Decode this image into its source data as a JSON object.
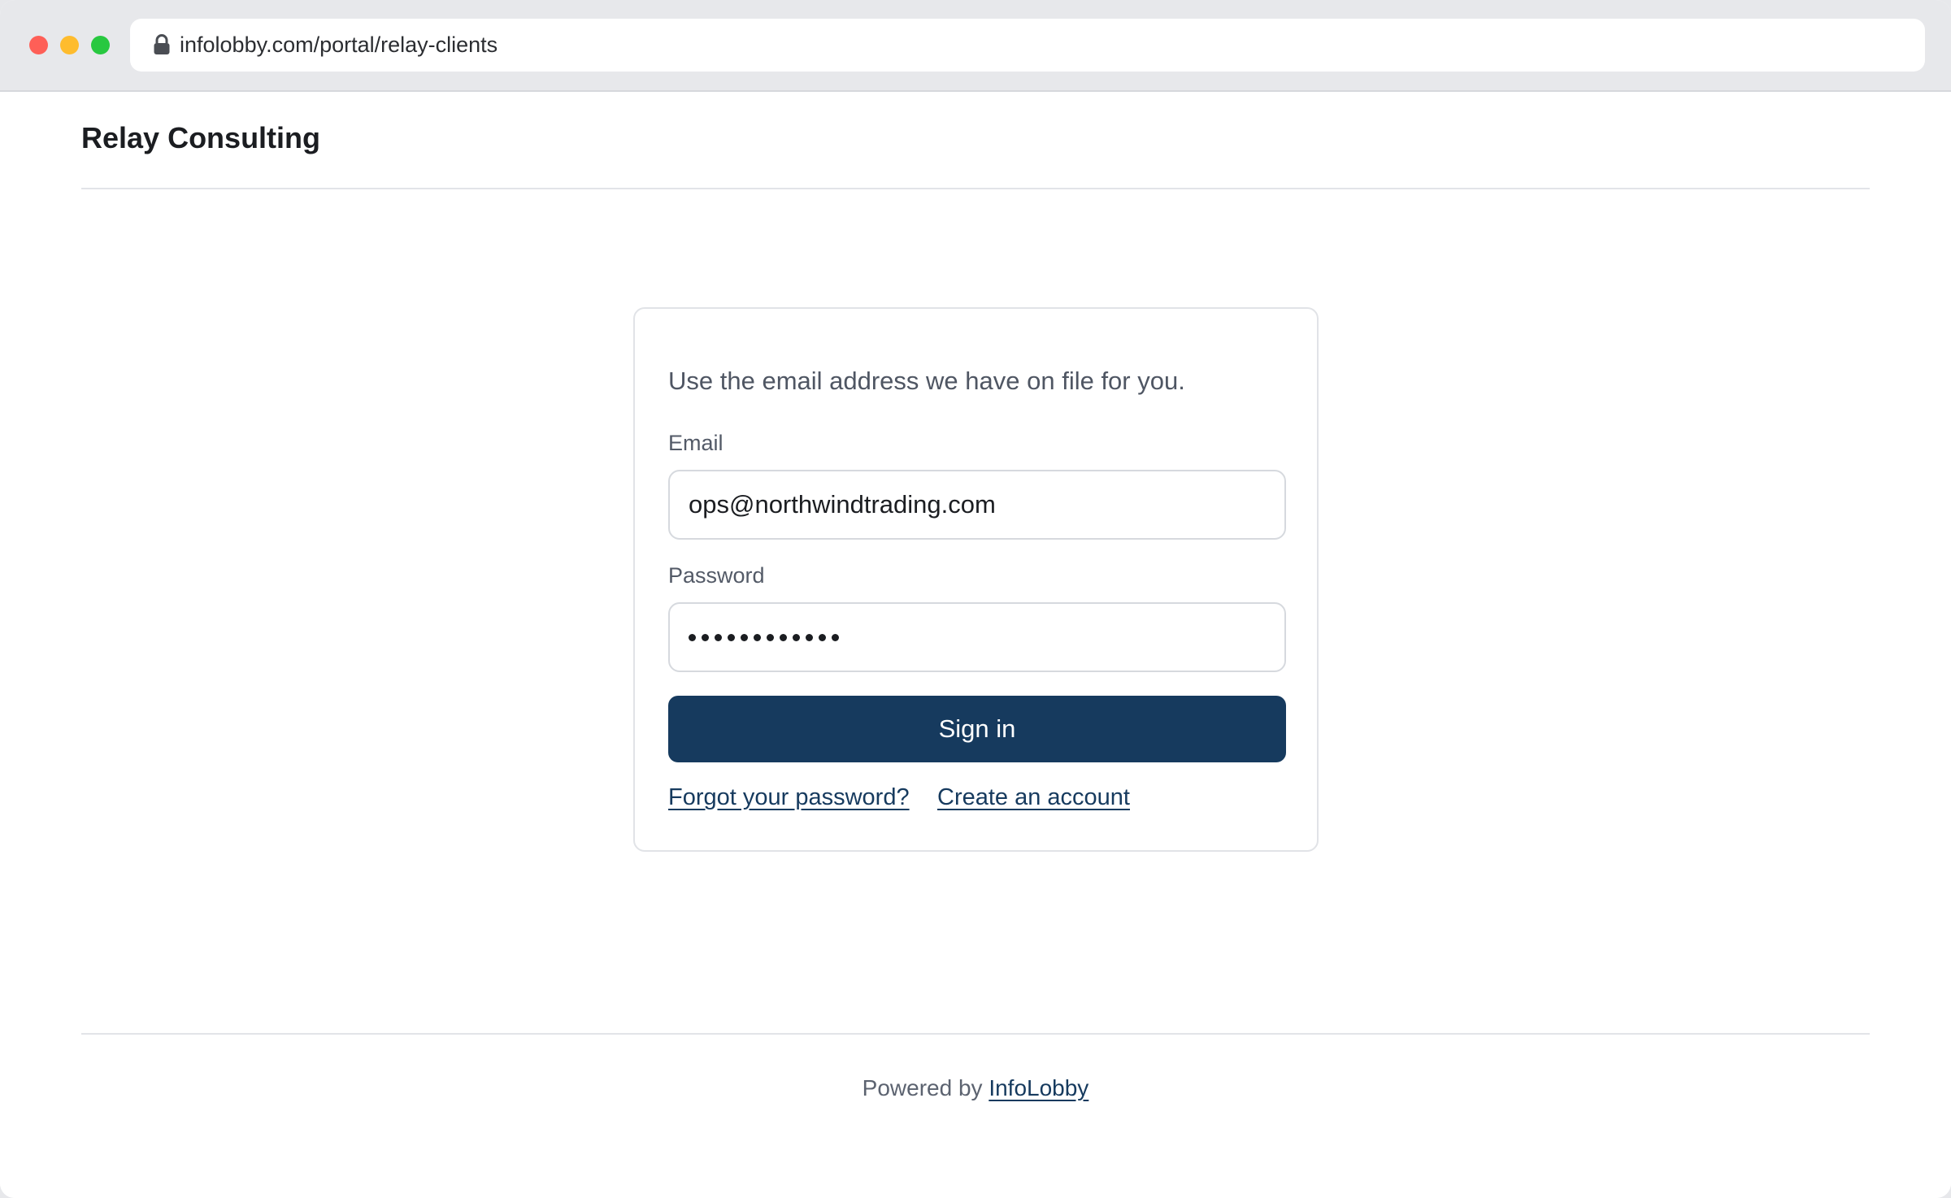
{
  "browser": {
    "url": "infolobby.com/portal/relay-clients",
    "url_icon": "lock-icon"
  },
  "header": {
    "brand": "Relay Consulting"
  },
  "login": {
    "intro": "Use the email address we have on file for you.",
    "email_label": "Email",
    "email_value": "ops@northwindtrading.com",
    "password_label": "Password",
    "password_mask_length": 12,
    "signin_label": "Sign in",
    "forgot_link": "Forgot your password?",
    "create_link": "Create an account"
  },
  "footer": {
    "prefix": "Powered by",
    "link": "InfoLobby"
  },
  "colors": {
    "accent": "#163a5e",
    "muted_text": "#4f5663",
    "chrome_bg": "#e7e8eb",
    "close": "#fe5f57",
    "minimize": "#febc2e",
    "maximize": "#28c840"
  }
}
